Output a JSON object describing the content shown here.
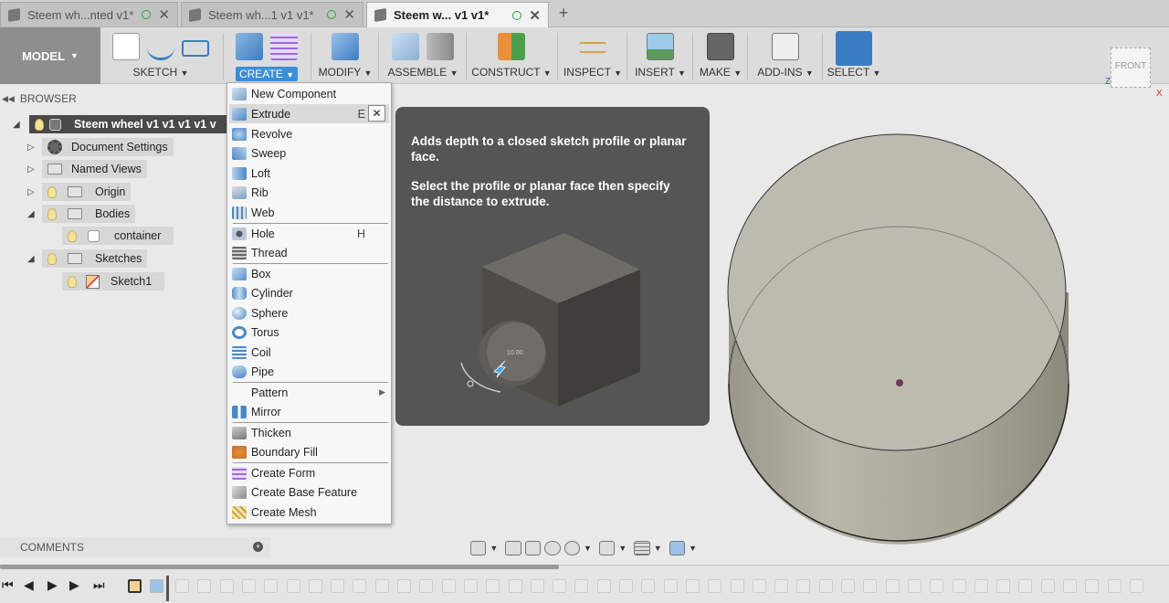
{
  "tabs": [
    {
      "label": "Steem wh...nted v1*",
      "active": false
    },
    {
      "label": "Steem wh...1 v1 v1*",
      "active": false
    },
    {
      "label": "Steem w... v1 v1*",
      "active": true
    }
  ],
  "toolbar": {
    "model_label": "MODEL",
    "groups": {
      "sketch": "SKETCH",
      "create": "CREATE",
      "modify": "MODIFY",
      "assemble": "ASSEMBLE",
      "construct": "CONSTRUCT",
      "inspect": "INSPECT",
      "insert": "INSERT",
      "make": "MAKE",
      "addins": "ADD-INS",
      "select": "SELECT"
    }
  },
  "viewcube": {
    "face": "FRONT",
    "axis_x": "X",
    "axis_z": "Z"
  },
  "browser": {
    "title": "BROWSER",
    "root": "Steem wheel v1 v1 v1 v1 v",
    "items": {
      "document_settings": "Document Settings",
      "named_views": "Named Views",
      "origin": "Origin",
      "bodies": "Bodies",
      "container": "container",
      "sketches": "Sketches",
      "sketch1": "Sketch1"
    }
  },
  "create_menu": {
    "items": [
      {
        "label": "New Component"
      },
      {
        "label": "Extrude",
        "shortcut": "E"
      },
      {
        "label": "Revolve"
      },
      {
        "label": "Sweep"
      },
      {
        "label": "Loft"
      },
      {
        "label": "Rib"
      },
      {
        "label": "Web"
      },
      {
        "label": "Hole",
        "shortcut": "H"
      },
      {
        "label": "Thread"
      },
      {
        "label": "Box"
      },
      {
        "label": "Cylinder"
      },
      {
        "label": "Sphere"
      },
      {
        "label": "Torus"
      },
      {
        "label": "Coil"
      },
      {
        "label": "Pipe"
      },
      {
        "label": "Pattern"
      },
      {
        "label": "Mirror"
      },
      {
        "label": "Thicken"
      },
      {
        "label": "Boundary Fill"
      },
      {
        "label": "Create Form"
      },
      {
        "label": "Create Base Feature"
      },
      {
        "label": "Create Mesh"
      }
    ]
  },
  "tooltip": {
    "line1": "Adds depth to a closed sketch profile or planar face.",
    "line2": "Select the profile or planar face then specify the distance to extrude.",
    "dimension": "10.00"
  },
  "comments": {
    "label": "COMMENTS"
  },
  "colors": {
    "accent": "#3b8ed8",
    "select_blue": "#3b7dc4",
    "tooltip_bg": "#555555",
    "body_fill": "#a9a597"
  }
}
